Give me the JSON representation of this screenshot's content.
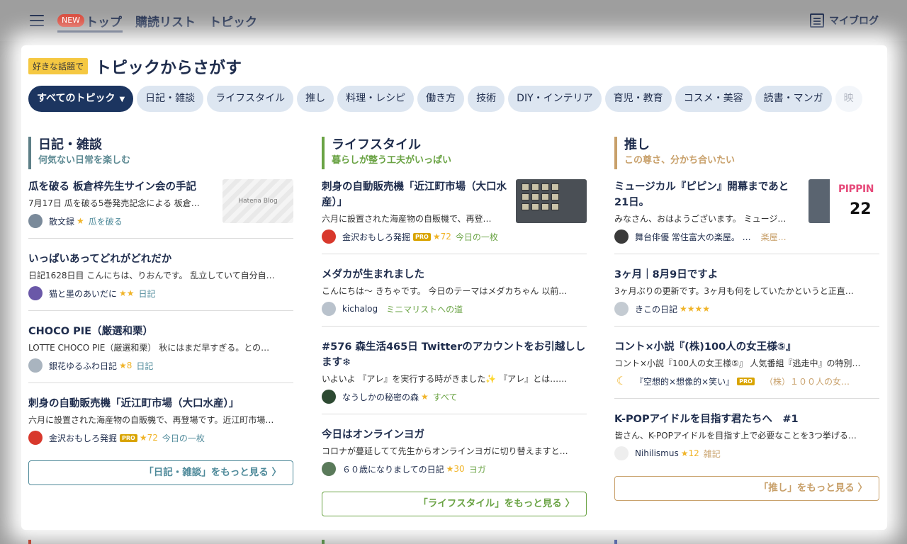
{
  "header": {
    "new_badge": "NEW",
    "tabs": [
      {
        "label": "トップ"
      },
      {
        "label": "購読リスト"
      },
      {
        "label": "トピック"
      }
    ],
    "myblog_label": "マイブログ"
  },
  "section": {
    "tag": "好きな話題で",
    "title": "トピックからさがす"
  },
  "chips": [
    {
      "label": "すべてのトピック"
    },
    {
      "label": "日記・雑談"
    },
    {
      "label": "ライフスタイル"
    },
    {
      "label": "推し"
    },
    {
      "label": "料理・レシピ"
    },
    {
      "label": "働き方"
    },
    {
      "label": "技術"
    },
    {
      "label": "DIY・インテリア"
    },
    {
      "label": "育児・教育"
    },
    {
      "label": "コスメ・美容"
    },
    {
      "label": "読書・マンガ"
    },
    {
      "label": "映"
    }
  ],
  "columns": [
    {
      "name": "日記・雑談",
      "sub": "何気ない日常を楽しむ",
      "more": "「日記・雑談」をもっと見る 〉",
      "entries": [
        {
          "title": "瓜を破る 板倉梓先生サイン会の手記",
          "excerpt": "7月17日 瓜を破る5巻発売記念による 板倉…",
          "blog": "散文録",
          "stars": "★",
          "pro": "",
          "category": "瓜を破る",
          "thumb_label": "Hatena Blog"
        },
        {
          "title": "いっぱいあってどれがどれだか",
          "excerpt": "日記1628日目 こんにちは、りおんです。 乱立していて自分自…",
          "blog": "猫と墨のあいだに",
          "stars": "★★",
          "pro": "",
          "category": "日記"
        },
        {
          "title": "CHOCO PIE（厳選和栗）",
          "excerpt": "LOTTE CHOCO PIE（厳選和栗） 秋にはまだ早すぎる。との…",
          "blog": "銀花ゆるふわ日記",
          "stars": "★8",
          "pro": "",
          "category": "日記"
        },
        {
          "title": "刺身の自動販売機「近江町市場（大口水産）」",
          "excerpt": "六月に設置された海産物の自販機で、再登場です。近江町市場…",
          "blog": "金沢おもしろ発掘",
          "stars": "★72",
          "pro": "PRO",
          "category": "今日の一枚"
        }
      ]
    },
    {
      "name": "ライフスタイル",
      "sub": "暮らしが整う工夫がいっぱい",
      "more": "「ライフスタイル」をもっと見る 〉",
      "entries": [
        {
          "title": "刺身の自動販売機「近江町市場（大口水産）」",
          "excerpt": "六月に設置された海産物の自販機で、再登…",
          "blog": "金沢おもしろ発掘",
          "stars": "★72",
          "pro": "PRO",
          "category": "今日の一枚"
        },
        {
          "title": "メダカが生まれました",
          "excerpt": "こんにちは〜 きちゃです。 今日のテーマはメダカちゃん 以前…",
          "blog": "kichalog",
          "stars": "",
          "pro": "",
          "category": "ミニマリストへの道"
        },
        {
          "title": "#576 森生活465日 Twitterのアカウントをお引越しします❄",
          "excerpt": "いよいよ 『アレ』を実行する時がきました✨ 『アレ』とは……",
          "blog": "なうしかの秘密の森",
          "stars": "★",
          "pro": "",
          "category": "すべて"
        },
        {
          "title": "今日はオンラインヨガ",
          "excerpt": "コロナが蔓延してて先生からオンラインヨガに切り替えますと…",
          "blog": "６０歳になりましての日記",
          "stars": "★30",
          "pro": "",
          "category": "ヨガ"
        }
      ]
    },
    {
      "name": "推し",
      "sub": "この尊さ、分かち合いたい",
      "more": "「推し」をもっと見る 〉",
      "entries": [
        {
          "title": "ミュージカル『ピピン』開幕まであと21日。",
          "excerpt": "みなさん、おはようございます。 ミュージ…",
          "blog": "舞台俳優 常住富大の楽屋。 …",
          "stars": "",
          "pro": "",
          "category": "楽屋…",
          "thumb_logo": "PIPPIN",
          "thumb_count": "22"
        },
        {
          "title": "3ヶ月｜8月9日ですよ",
          "excerpt": "3ヶ月ぶりの更新です。3ヶ月も何をしていたかというと正直…",
          "blog": "きこの日記",
          "stars": "★★★★",
          "pro": "",
          "category": ""
        },
        {
          "title": "コント×小説『(株)100人の女王様⑤』",
          "excerpt": "コント×小説『100人の女王様⑤』 人気番組『逃走中』の特別…",
          "blog": "『空想的×想像的×笑い』",
          "stars": "",
          "pro": "PRO",
          "category": "（株）１００人の女…"
        },
        {
          "title": "K-POPアイドルを目指す君たちへ　#1",
          "excerpt": "皆さん、K-POPアイドルを目指す上で必要なことを3つ挙げる…",
          "blog": "Nihilismus",
          "stars": "★12",
          "pro": "",
          "category": "雑記"
        }
      ]
    }
  ],
  "colors": {
    "navy": "#1c3560",
    "chip_bg": "#dde6f1",
    "diary_accent": "#4f8a9a",
    "lifestyle_accent": "#6aa344",
    "oshi_accent": "#c8a06a",
    "star": "#f0b429",
    "pro_badge": "#d9a400"
  }
}
